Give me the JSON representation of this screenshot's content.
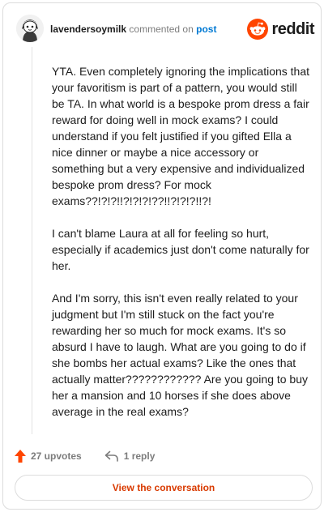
{
  "header": {
    "username": "lavendersoymilk",
    "commented_on": "commented on",
    "post_link": "post",
    "brand": "reddit"
  },
  "comment": {
    "paragraphs": [
      "YTA. Even completely ignoring the implications that your favoritism is part of a pattern, you would still be TA. In what world is a bespoke prom dress a fair reward for doing well in mock exams? I could understand if you felt justified if you gifted Ella a nice dinner or maybe a nice accessory or something but a very expensive and individualized bespoke prom dress? For mock exams??!?!?!!?!?!?!??!!?!?!?!!?!",
      "I can't blame Laura at all for feeling so hurt, especially if academics just don't come naturally for her.",
      "And I'm sorry, this isn't even really related to your judgment but I'm still stuck on the fact you're rewarding her so much for mock exams. It's so absurd I have to laugh. What are you going to do if she bombs her actual exams? Like the ones that actually matter???????????? Are you going to buy her a mansion and 10 horses if she does above average in the real exams?"
    ]
  },
  "actions": {
    "upvotes": "27 upvotes",
    "replies": "1 reply"
  },
  "cta": {
    "label": "View the conversation"
  },
  "colors": {
    "brand": "#ff4500",
    "link": "#0079d3",
    "cta_text": "#d93a00"
  },
  "icons": {
    "avatar": "snoo-avatar",
    "logo": "reddit-logo-icon",
    "upvote": "upvote-arrow-icon",
    "reply": "reply-arrow-icon"
  }
}
